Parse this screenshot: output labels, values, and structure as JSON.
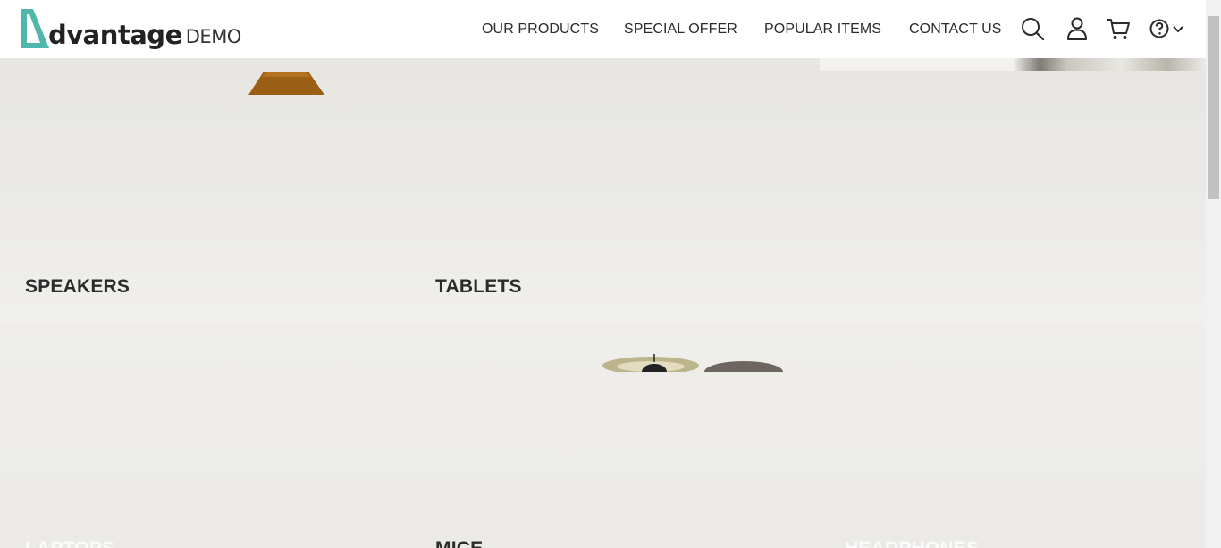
{
  "header": {
    "logo_word": "dvantage",
    "logo_suffix": "DEMO",
    "nav": {
      "products": "OUR PRODUCTS",
      "offer": "SPECIAL OFFER",
      "popular": "POPULAR ITEMS",
      "contact": "CONTACT US"
    },
    "icons": [
      "search-icon",
      "user-icon",
      "cart-icon",
      "help-icon",
      "chevron-down-icon"
    ]
  },
  "categories": {
    "speakers": "SPEAKERS",
    "tablets": "TABLETS",
    "laptops": "LAPTOPS",
    "mice": "MICE",
    "headphones": "HEADPHONES"
  },
  "colors": {
    "brand_teal": "#4fb7ac",
    "text_dark": "#2b2b2b",
    "header_bg": "#ffffff",
    "tile_bg": "#ebeae6"
  }
}
